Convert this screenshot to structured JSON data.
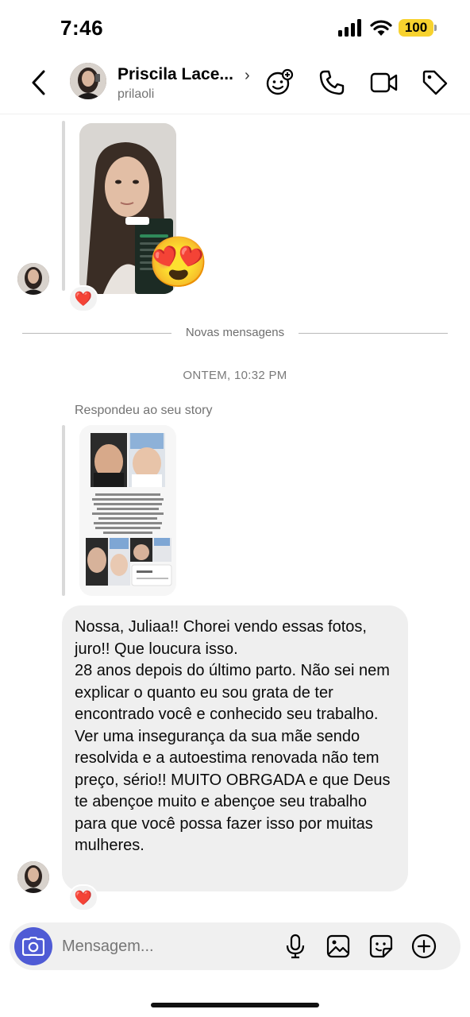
{
  "status_bar": {
    "time": "7:46",
    "battery": "100",
    "battery_color": "#f7d22e"
  },
  "header": {
    "back_icon": "chevron-left-icon",
    "contact_name": "Priscila Lace...",
    "contact_handle": "prilaoli",
    "actions": [
      "effects-icon",
      "phone-icon",
      "video-icon",
      "tag-icon"
    ]
  },
  "messages": {
    "first_story_reaction_emoji": "😍",
    "first_story_heart": "❤️",
    "divider_label": "Novas mensagens",
    "timestamp": "ONTEM, 10:32 PM",
    "story_reply_caption": "Respondeu ao seu story",
    "text_message": {
      "line1": "Nossa, Juliaa!! Chorei vendo essas fotos, juro!! Que loucura isso.",
      "line2": "28 anos depois do último parto. Não sei nem explicar o quanto eu sou grata de ter encontrado você e conhecido seu trabalho. Ver uma insegurança da sua mãe sendo resolvida e a autoestima renovada não tem preço, sério!! MUITO OBRGADA e que Deus te abençoe muito e abençoe seu trabalho para que você possa fazer isso por muitas mulheres."
    },
    "text_message_heart": "❤️"
  },
  "composer": {
    "placeholder": "Mensagem...",
    "accent_color": "#4f5bd5",
    "icons": [
      "microphone-icon",
      "image-icon",
      "sticker-icon",
      "plus-icon"
    ]
  }
}
